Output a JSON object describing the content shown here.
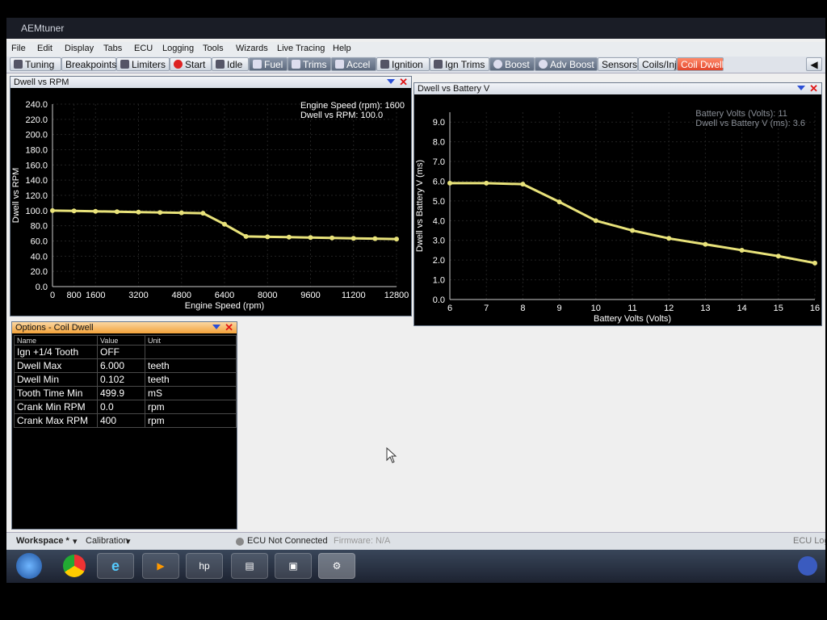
{
  "app": {
    "title": "AEMtuner"
  },
  "menu": [
    "File",
    "Edit",
    "Display",
    "Tabs",
    "ECU",
    "Logging",
    "Tools",
    "Wizards",
    "Live Tracing",
    "Help"
  ],
  "tabs": [
    "Tuning",
    "Breakpoints",
    "Limiters",
    "Start",
    "Idle",
    "Fuel",
    "Trims",
    "Accel",
    "Ignition",
    "Ign Trims",
    "Boost",
    "Adv Boost",
    "Sensors",
    "Coils/Inj",
    "Coil Dwell"
  ],
  "panels": {
    "rpm": {
      "title": "Dwell vs RPM",
      "readout1": "Engine Speed (rpm): 1600",
      "readout2": "Dwell vs RPM: 100.0"
    },
    "batt": {
      "title": "Dwell vs Battery V",
      "readout1": "Battery Volts (Volts): 11",
      "readout2": "Dwell vs Battery V (ms): 3.6"
    },
    "options": {
      "title": "Options - Coil Dwell",
      "headers": [
        "Name",
        "Value",
        "Unit"
      ],
      "rows": [
        [
          "Ign +1/4 Tooth",
          "OFF",
          ""
        ],
        [
          "Dwell Max",
          "6.000",
          "teeth"
        ],
        [
          "Dwell Min",
          "0.102",
          "teeth"
        ],
        [
          "Tooth Time Min",
          "499.9",
          "mS"
        ],
        [
          "Crank Min RPM",
          "0.0",
          "rpm"
        ],
        [
          "Crank Max RPM",
          "400",
          "rpm"
        ]
      ]
    }
  },
  "chart_data": [
    {
      "type": "line",
      "xlabel": "Engine Speed (rpm)",
      "ylabel": "Dwell vs RPM",
      "xlim": [
        0,
        12800
      ],
      "ylim": [
        0,
        240
      ],
      "xticks": [
        0,
        800,
        1600,
        3200,
        4800,
        6400,
        8000,
        9600,
        11200,
        12800
      ],
      "yticks": [
        "0.0",
        "20.0",
        "40.0",
        "60.0",
        "80.0",
        "100.0",
        "120.0",
        "140.0",
        "160.0",
        "180.0",
        "200.0",
        "220.0",
        "240.0"
      ],
      "x": [
        0,
        800,
        1600,
        2400,
        3200,
        4000,
        4800,
        5600,
        6400,
        7200,
        8000,
        8800,
        9600,
        10400,
        11200,
        12000,
        12800
      ],
      "values": [
        100,
        99.5,
        99,
        98.5,
        98,
        97.5,
        97,
        96.5,
        82,
        66,
        65.5,
        65,
        64.5,
        64,
        63.5,
        63,
        62.5
      ],
      "grid": true,
      "color": "#e8e27a"
    },
    {
      "type": "line",
      "xlabel": "Battery Volts (Volts)",
      "ylabel": "Dwell vs Battery V (ms)",
      "xlim": [
        6,
        16
      ],
      "ylim": [
        0,
        9.5
      ],
      "xticks": [
        6,
        7,
        8,
        9,
        10,
        11,
        12,
        13,
        14,
        15,
        16
      ],
      "yticks": [
        "0.0",
        "1.0",
        "2.0",
        "3.0",
        "4.0",
        "5.0",
        "6.0",
        "7.0",
        "8.0",
        "9.0"
      ],
      "x": [
        6,
        7,
        8,
        9,
        10,
        11,
        12,
        13,
        14,
        15,
        16
      ],
      "values": [
        5.9,
        5.9,
        5.85,
        4.95,
        4.0,
        3.5,
        3.1,
        2.8,
        2.5,
        2.2,
        1.85
      ],
      "grid": true,
      "color": "#e8e27a"
    }
  ],
  "status": {
    "workspace": "Workspace *",
    "calibration": "Calibration",
    "ecu": "ECU Not Connected",
    "firmware": "Firmware: N/A",
    "ecu_log": "ECU Log"
  }
}
